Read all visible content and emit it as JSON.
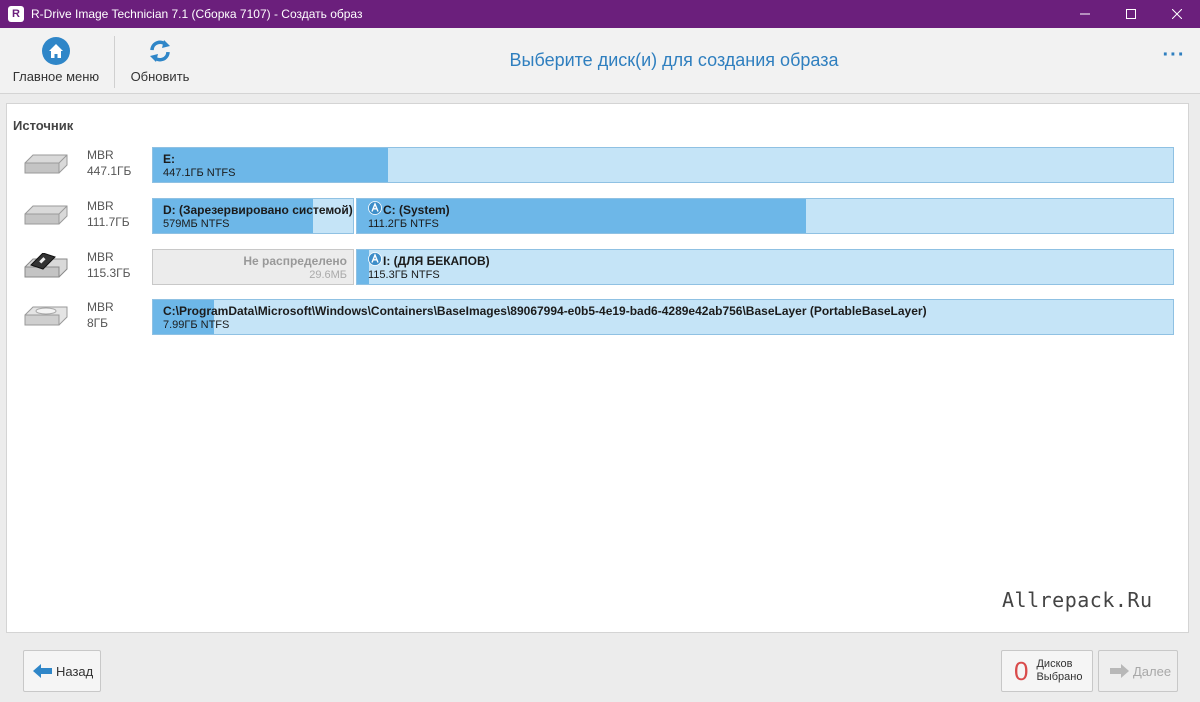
{
  "window": {
    "title": "R-Drive Image Technician 7.1 (Сборка 7107) - Создать образ",
    "logo_letter": "R",
    "controls": {
      "minimize": "—",
      "maximize": "☐",
      "close": "✕"
    }
  },
  "toolbar": {
    "home_label": "Главное меню",
    "refresh_label": "Обновить",
    "page_title": "Выберите диск(и) для создания образа",
    "more_label": "···"
  },
  "source": {
    "label": "Источник",
    "disks": [
      {
        "icon": "hdd-icon",
        "scheme": "MBR",
        "size": "447.1ГБ",
        "partitions": [
          {
            "name": "E:",
            "size": "447.1ГБ NTFS",
            "used_fraction": 0.23,
            "width_fraction": 1.0
          }
        ]
      },
      {
        "icon": "hdd-icon",
        "scheme": "MBR",
        "size": "111.7ГБ",
        "partitions": [
          {
            "name": "D: (Зарезервировано системой)",
            "size": "579МБ NTFS",
            "used_fraction": 0.8,
            "width_fraction": 0.2
          },
          {
            "name": "C: (System)",
            "size": "111.2ГБ NTFS",
            "used_fraction": 0.55,
            "width_fraction": 0.8,
            "lock": true
          }
        ]
      },
      {
        "icon": "usb-drive-icon",
        "scheme": "MBR",
        "size": "115.3ГБ",
        "partitions": [
          {
            "name": "Не распределено",
            "size": "29.6МБ",
            "used_fraction": 0,
            "width_fraction": 0.2,
            "unallocated": true
          },
          {
            "name": "I: (ДЛЯ БЕКАПОВ)",
            "size": "115.3ГБ NTFS",
            "used_fraction": 0.01,
            "width_fraction": 0.8,
            "lock": true
          }
        ]
      },
      {
        "icon": "virtual-disk-icon",
        "scheme": "MBR",
        "size": "8ГБ",
        "partitions": [
          {
            "name": "C:\\ProgramData\\Microsoft\\Windows\\Containers\\BaseImages\\89067994-e0b5-4e19-bad6-4289e42ab756\\BaseLayer (PortableBaseLayer)",
            "size": "7.99ГБ NTFS",
            "used_fraction": 0.06,
            "width_fraction": 1.0
          }
        ]
      }
    ]
  },
  "watermark": "Allrepack.Ru",
  "footer": {
    "back_label": "Назад",
    "selected_count": "0",
    "selected_label_1": "Дисков",
    "selected_label_2": "Выбрано",
    "next_label": "Далее"
  },
  "colors": {
    "titlebar": "#6b1f7c",
    "accent": "#2f7fbf",
    "partition_fill": "#6db7e8",
    "partition_bg": "#c5e4f7",
    "count": "#d94b4b"
  }
}
